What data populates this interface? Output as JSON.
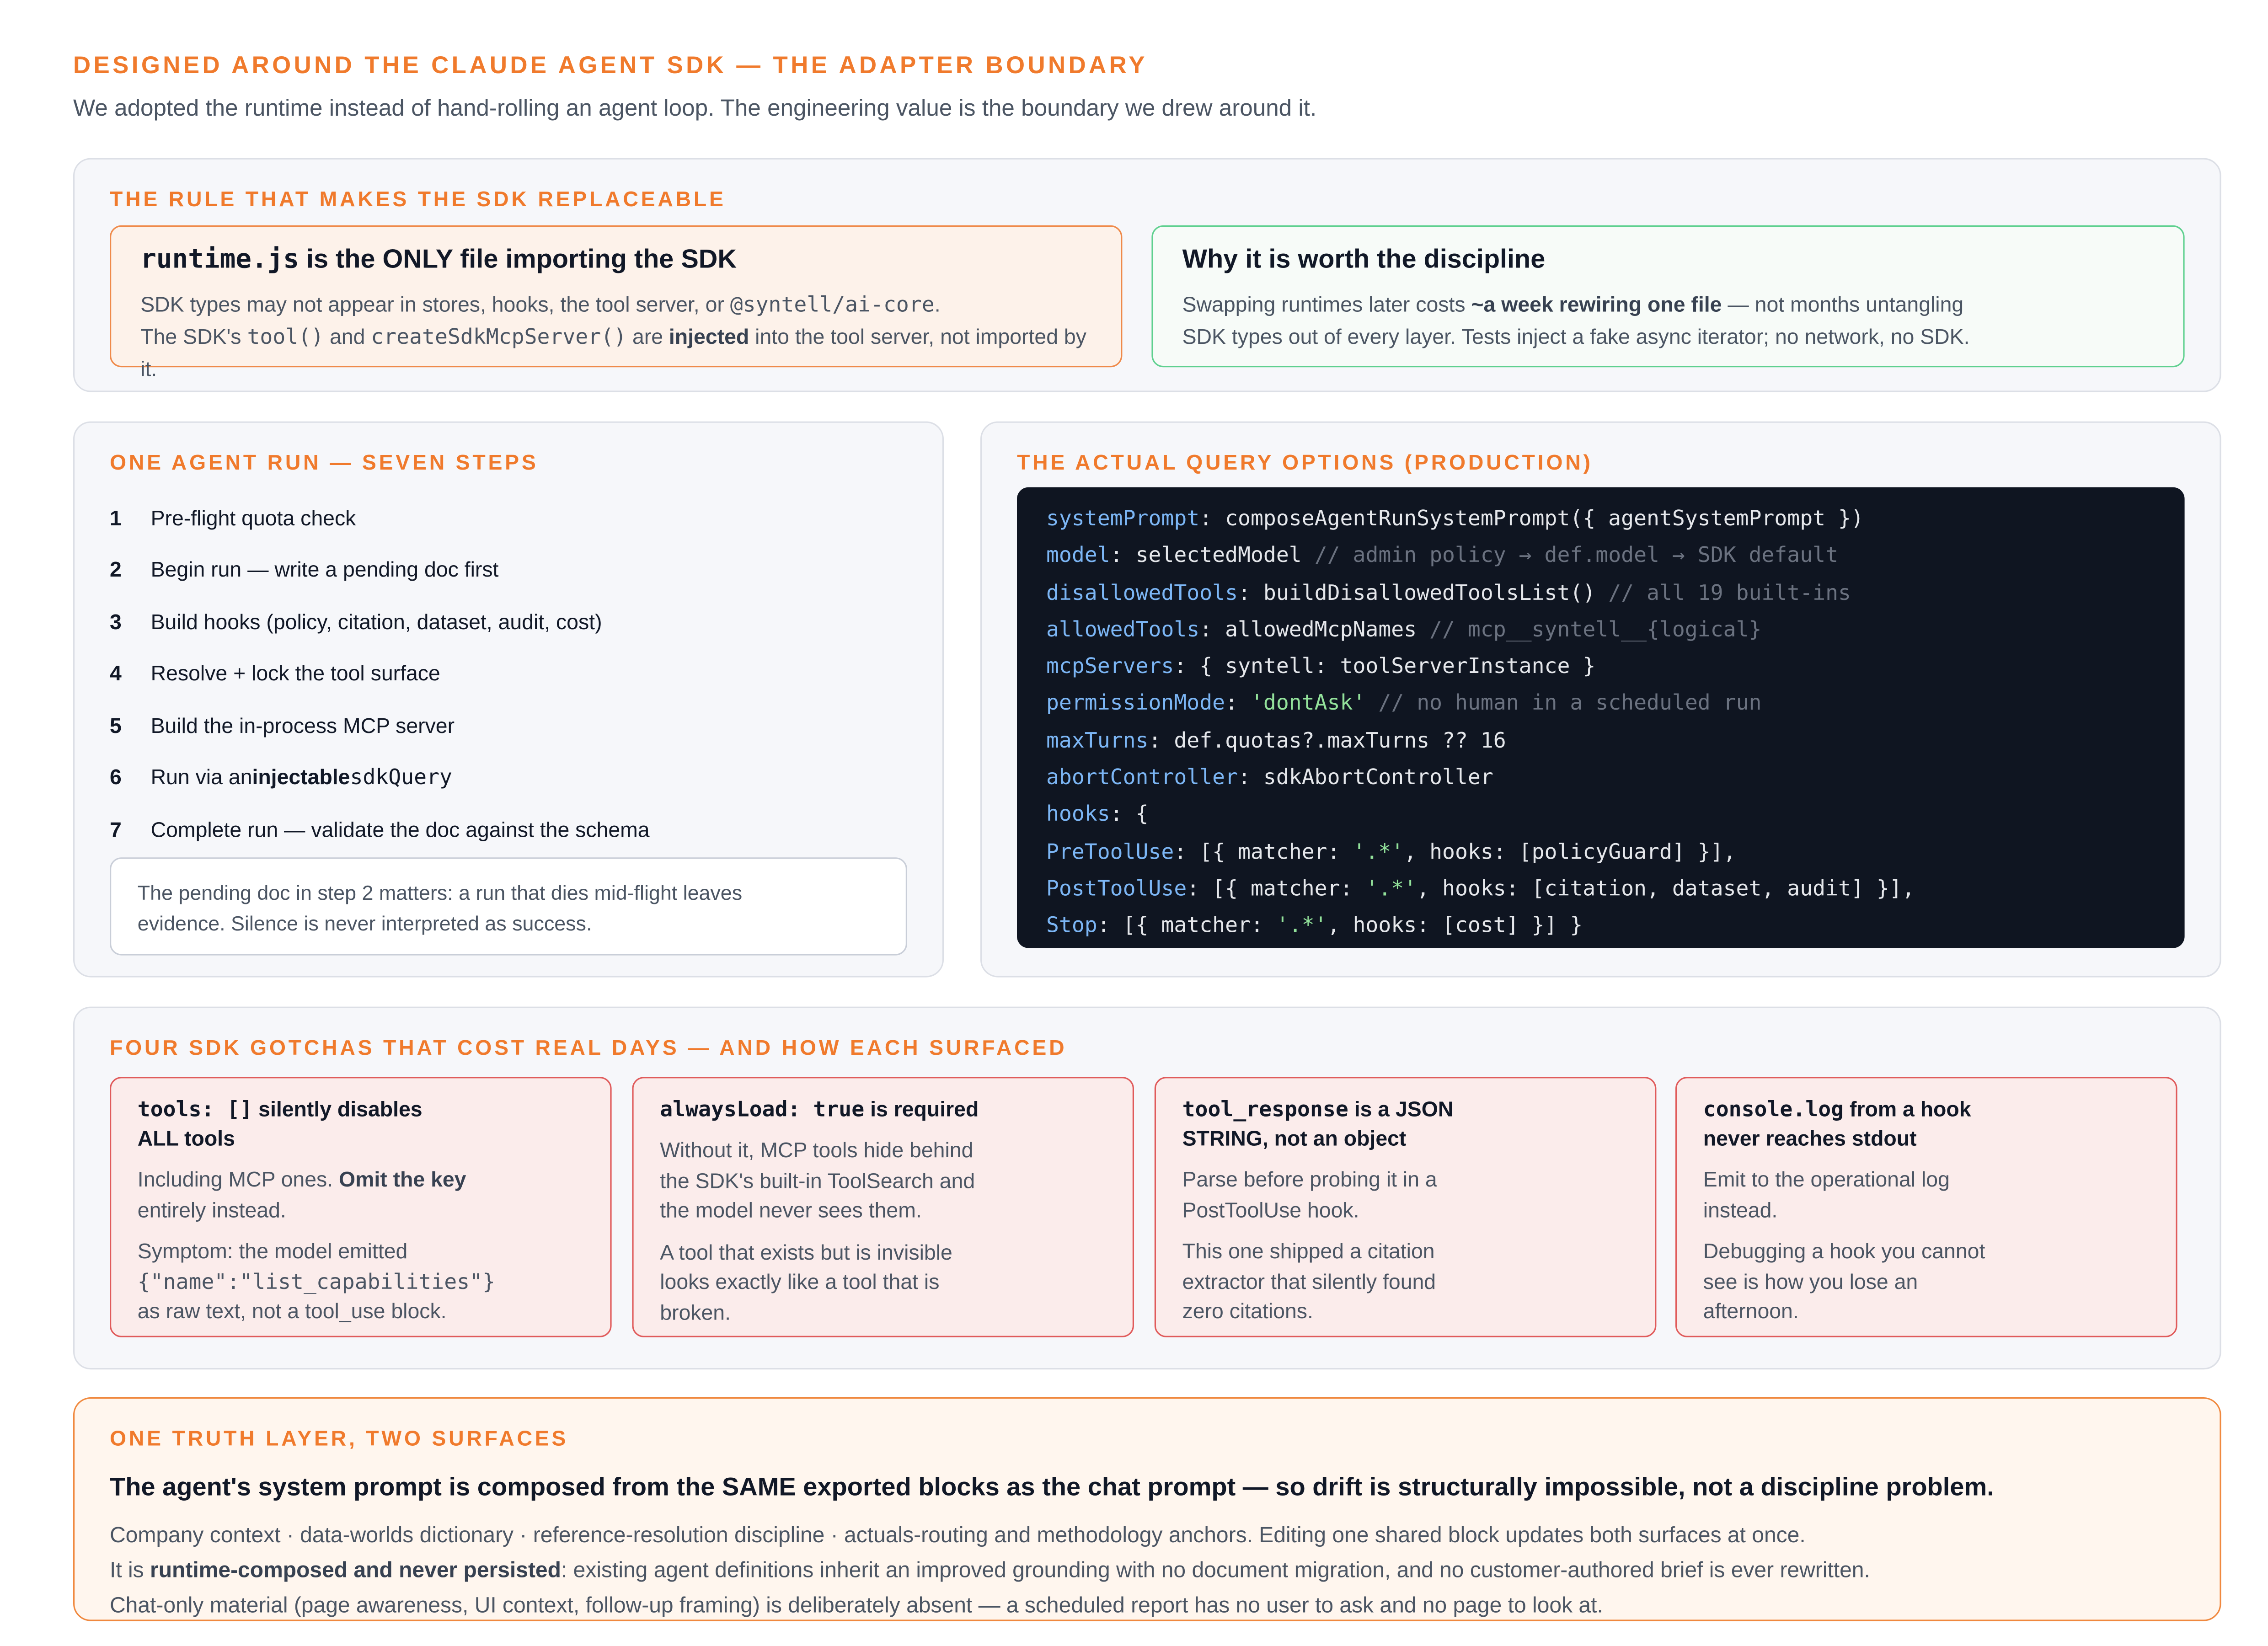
{
  "hero": {
    "title": "DESIGNED AROUND THE CLAUDE AGENT SDK — THE ADAPTER BOUNDARY",
    "subtitle": "We adopted the runtime instead of hand-rolling an agent loop. The engineering value is the boundary we drew around it."
  },
  "rule": {
    "heading": "THE RULE THAT MAKES THE SDK REPLACEABLE",
    "left": {
      "title_code": "runtime.js",
      "title_rest": " is the ONLY file importing the SDK",
      "line1_a": "SDK types may not appear in stores, hooks, the tool server, or ",
      "line1_code": "@syntell/ai-core",
      "line1_b": ".",
      "line2_a": "The SDK's ",
      "line2_code1": "tool()",
      "line2_b": " and ",
      "line2_code2": "createSdkMcpServer()",
      "line2_c": " are ",
      "line2_bold": "injected",
      "line2_d": " into the tool server, not imported by it."
    },
    "right": {
      "title": "Why it is worth the discipline",
      "line1_a": "Swapping runtimes later costs ",
      "line1_bold": "~a week rewiring one file",
      "line1_b": " — not months untangling",
      "line2": "SDK types out of every layer. Tests inject a fake async iterator; no network, no SDK."
    }
  },
  "run": {
    "heading": "ONE AGENT RUN — SEVEN STEPS",
    "steps": [
      {
        "num": "1",
        "text": "Pre-flight quota check"
      },
      {
        "num": "2",
        "text": "Begin run — write a pending doc first"
      },
      {
        "num": "3",
        "text": "Build hooks (policy, citation, dataset, audit, cost)"
      },
      {
        "num": "4",
        "text": "Resolve + lock the tool surface"
      },
      {
        "num": "5",
        "text": "Build the in-process MCP server"
      },
      {
        "num": "6",
        "text_a": "Run via an ",
        "text_bold": "injectable",
        "text_b": " ",
        "text_code": "sdkQuery"
      },
      {
        "num": "7",
        "text": "Complete run — validate the doc against the schema"
      }
    ],
    "note_line1": "The pending doc in step 2 matters: a run that dies mid-flight leaves",
    "note_line2": "evidence. Silence is never interpreted as success."
  },
  "query": {
    "heading": "THE ACTUAL QUERY OPTIONS (PRODUCTION)",
    "lines": [
      [
        {
          "t": "key",
          "v": "systemPrompt"
        },
        {
          "t": "plain",
          "v": ": composeAgentRunSystemPrompt({ agentSystemPrompt })"
        }
      ],
      [
        {
          "t": "key",
          "v": "model"
        },
        {
          "t": "plain",
          "v": ": selectedModel "
        },
        {
          "t": "com",
          "v": "// admin policy → def.model → SDK default"
        }
      ],
      [
        {
          "t": "key",
          "v": "disallowedTools"
        },
        {
          "t": "plain",
          "v": ": buildDisallowedToolsList() "
        },
        {
          "t": "com",
          "v": "// all 19 built-ins"
        }
      ],
      [
        {
          "t": "key",
          "v": "allowedTools"
        },
        {
          "t": "plain",
          "v": ": allowedMcpNames "
        },
        {
          "t": "com",
          "v": "// mcp__syntell__{logical}"
        }
      ],
      [
        {
          "t": "key",
          "v": "mcpServers"
        },
        {
          "t": "plain",
          "v": ": { syntell: toolServerInstance }"
        }
      ],
      [
        {
          "t": "key",
          "v": "permissionMode"
        },
        {
          "t": "plain",
          "v": ": "
        },
        {
          "t": "str",
          "v": "'dontAsk'"
        },
        {
          "t": "plain",
          "v": " "
        },
        {
          "t": "com",
          "v": "// no human in a scheduled run"
        }
      ],
      [
        {
          "t": "key",
          "v": "maxTurns"
        },
        {
          "t": "plain",
          "v": ": def.quotas?.maxTurns ?? 16"
        }
      ],
      [
        {
          "t": "key",
          "v": "abortController"
        },
        {
          "t": "plain",
          "v": ": sdkAbortController"
        }
      ],
      [
        {
          "t": "key",
          "v": "hooks"
        },
        {
          "t": "plain",
          "v": ": {"
        }
      ],
      [
        {
          "t": "key",
          "v": "PreToolUse"
        },
        {
          "t": "plain",
          "v": ": [{ matcher: "
        },
        {
          "t": "str",
          "v": "'.*'"
        },
        {
          "t": "plain",
          "v": ", hooks: [policyGuard] }],"
        }
      ],
      [
        {
          "t": "key",
          "v": "PostToolUse"
        },
        {
          "t": "plain",
          "v": ": [{ matcher: "
        },
        {
          "t": "str",
          "v": "'.*'"
        },
        {
          "t": "plain",
          "v": ", hooks: [citation, dataset, audit] }],"
        }
      ],
      [
        {
          "t": "key",
          "v": "Stop"
        },
        {
          "t": "plain",
          "v": ": [{ matcher: "
        },
        {
          "t": "str",
          "v": "'.*'"
        },
        {
          "t": "plain",
          "v": ", hooks: [cost] }] }"
        }
      ]
    ]
  },
  "gotchas": {
    "heading": "FOUR SDK GOTCHAS THAT COST REAL DAYS — AND HOW EACH SURFACED",
    "g1": {
      "title_code": "tools: []",
      "title_rest": " silently disables",
      "title_line2": "ALL tools",
      "p1_a": "Including MCP ones. ",
      "p1_bold": "Omit the key",
      "p1_b": "entirely instead.",
      "p2_a": "Symptom: the model emitted",
      "p2_code": "{\"name\":\"list_capabilities\"}",
      "p2_b": "as raw text, not a tool_use block."
    },
    "g2": {
      "title_code": "alwaysLoad: true",
      "title_rest": " is required",
      "p1_l1": "Without it, MCP tools hide behind",
      "p1_l2": "the SDK's built-in ToolSearch and",
      "p1_l3": "the model never sees them.",
      "p2_l1": "A tool that exists but is invisible",
      "p2_l2": "looks exactly like a tool that is",
      "p2_l3": "broken."
    },
    "g3": {
      "title_code": "tool_response",
      "title_rest": " is a JSON",
      "title_line2": "STRING, not an object",
      "p1_l1": "Parse before probing it in a",
      "p1_l2": "PostToolUse hook.",
      "p2_l1": "This one shipped a citation",
      "p2_l2": "extractor that silently found",
      "p2_l3": "zero citations."
    },
    "g4": {
      "title_code": "console.log",
      "title_rest": " from a hook",
      "title_line2": "never reaches stdout",
      "p1_l1": "Emit to the operational log",
      "p1_l2": "instead.",
      "p2_l1": "Debugging a hook you cannot",
      "p2_l2": "see is how you lose an",
      "p2_l3": "afternoon."
    }
  },
  "truth": {
    "heading": "ONE TRUTH LAYER, TWO SURFACES",
    "headline": "The agent's system prompt is composed from the SAME exported blocks as the chat prompt — so drift is structurally impossible, not a discipline problem.",
    "line1": "Company context · data-worlds dictionary · reference-resolution discipline · actuals-routing and methodology anchors. Editing one shared block updates both surfaces at once.",
    "line2_a": "It is ",
    "line2_bold": "runtime-composed and never persisted",
    "line2_b": ": existing agent definitions inherit an improved grounding with no document migration, and no customer-authored brief is ever rewritten.",
    "line3": "Chat-only material (page awareness, UI context, follow-up framing) is deliberately absent — a scheduled report has no user to ask and no page to look at."
  },
  "colors": {
    "accent_orange": "#f07a2c",
    "code_bg": "#0f1521",
    "code_key": "#7cb6f5",
    "code_string": "#93e29b",
    "gotcha_border": "#e05b5b",
    "green_border": "#5fd08f"
  }
}
